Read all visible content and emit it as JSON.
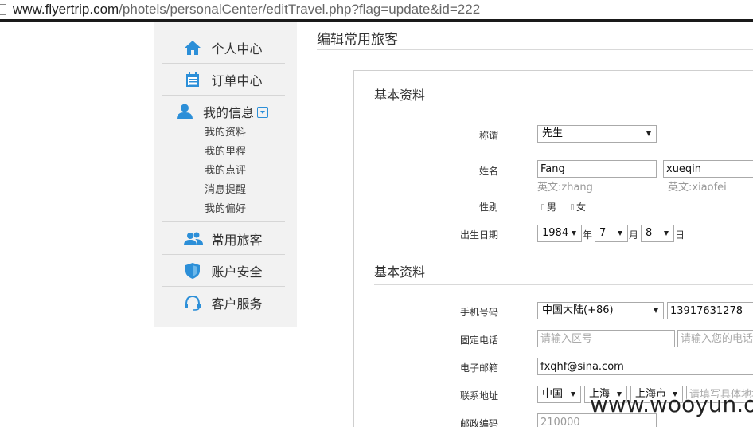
{
  "browser": {
    "url_host": "www.flyertrip.com",
    "url_path": "/photels/personalCenter/editTravel.php?flag=update&id=222"
  },
  "sidebar": {
    "items": [
      {
        "label": "个人中心",
        "icon": "home-icon"
      },
      {
        "label": "订单中心",
        "icon": "calendar-icon"
      },
      {
        "label": "我的信息",
        "icon": "user-icon"
      },
      {
        "label": "常用旅客",
        "icon": "users-icon"
      },
      {
        "label": "账户安全",
        "icon": "shield-icon"
      },
      {
        "label": "客户服务",
        "icon": "headset-icon"
      }
    ],
    "submenu": [
      "我的资料",
      "我的里程",
      "我的点评",
      "消息提醒",
      "我的偏好"
    ]
  },
  "main": {
    "page_title": "编辑常用旅客",
    "section1_title": "基本资料",
    "section2_title": "基本资料",
    "title_label": "称谓",
    "title_value": "先生",
    "name_label": "姓名",
    "surname_value": "Fang",
    "givenname_value": "xueqin",
    "surname_hint": "英文:zhang",
    "givenname_hint": "英文:xiaofei",
    "gender_label": "性别",
    "gender_male": "男",
    "gender_female": "女",
    "birth_label": "出生日期",
    "birth_year": "1984",
    "birth_year_unit": "年",
    "birth_month": "7",
    "birth_month_unit": "月",
    "birth_day": "8",
    "birth_day_unit": "日",
    "mobile_label": "手机号码",
    "mobile_country": "中国大陆(+86)",
    "mobile_value": "13917631278",
    "phone_label": "固定电话",
    "phone_area_placeholder": "请输入区号",
    "phone_number_placeholder": "请输入您的电话",
    "email_label": "电子邮箱",
    "email_value": "fxqhf@sina.com",
    "address_label": "联系地址",
    "address_country": "中国",
    "address_province": "上海",
    "address_city": "上海市",
    "address_detail_placeholder": "请填写具体地址",
    "zip_label": "邮政编码",
    "zip_value": "210000"
  },
  "watermark": "www.wooyun.org"
}
